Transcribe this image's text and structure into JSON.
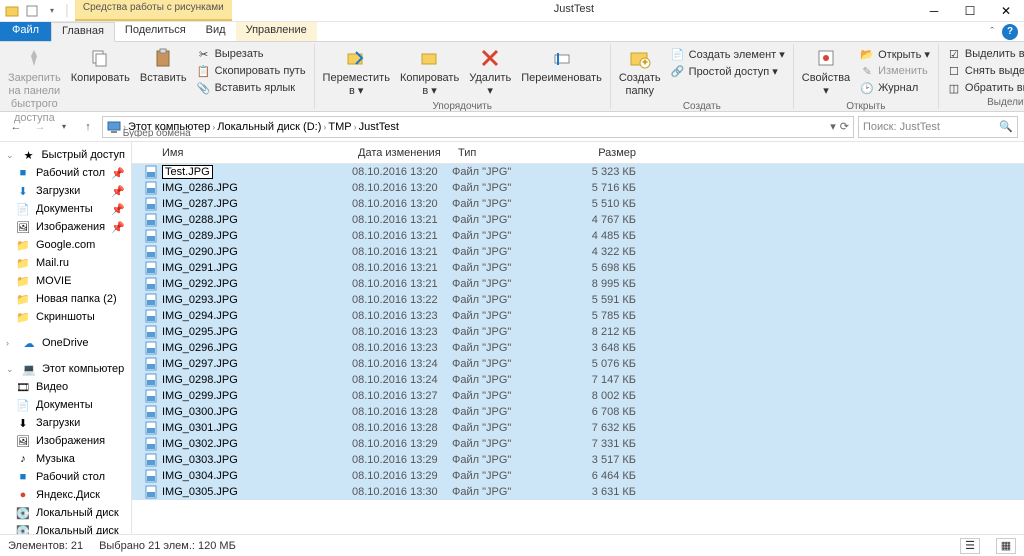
{
  "titlebar": {
    "contextual_tools": "Средства работы с рисунками",
    "title": "JustTest"
  },
  "tabs": {
    "file": "Файл",
    "home": "Главная",
    "share": "Поделиться",
    "view": "Вид",
    "management": "Управление"
  },
  "ribbon": {
    "clipboard": {
      "pin": "Закрепить на панели\nбыстрого доступа",
      "copy": "Копировать",
      "paste": "Вставить",
      "cut": "Вырезать",
      "copy_path": "Скопировать путь",
      "paste_shortcut": "Вставить ярлык",
      "label": "Буфер обмена"
    },
    "organize": {
      "move_to": "Переместить\nв ▾",
      "copy_to": "Копировать\nв ▾",
      "delete": "Удалить\n▾",
      "rename": "Переименовать",
      "label": "Упорядочить"
    },
    "create": {
      "folder": "Создать\nпапку",
      "new_item": "Создать элемент ▾",
      "easy_access": "Простой доступ ▾",
      "label": "Создать"
    },
    "open": {
      "properties": "Свойства\n▾",
      "open": "Открыть ▾",
      "edit": "Изменить",
      "history": "Журнал",
      "label": "Открыть"
    },
    "select": {
      "select_all": "Выделить все",
      "select_none": "Снять выделение",
      "invert": "Обратить выделение",
      "label": "Выделить"
    }
  },
  "breadcrumb": {
    "computer": "Этот компьютер",
    "drive": "Локальный диск (D:)",
    "tmp": "TMP",
    "folder": "JustTest"
  },
  "search": {
    "placeholder": "Поиск: JustTest"
  },
  "sidebar": {
    "quick_access": "Быстрый доступ",
    "desktop": "Рабочий стол",
    "downloads": "Загрузки",
    "documents": "Документы",
    "pictures": "Изображения",
    "google": "Google.com",
    "mailru": "Mail.ru",
    "movie": "MOVIE",
    "newfolder": "Новая папка (2)",
    "screenshots": "Скриншоты",
    "onedrive": "OneDrive",
    "this_pc": "Этот компьютер",
    "video": "Видео",
    "documents2": "Документы",
    "downloads2": "Загрузки",
    "pictures2": "Изображения",
    "music": "Музыка",
    "desktop2": "Рабочий стол",
    "yandex": "Яндекс.Диск",
    "local_c": "Локальный диск",
    "local_d": "Локальный диск"
  },
  "columns": {
    "name": "Имя",
    "date": "Дата изменения",
    "type": "Тип",
    "size": "Размер"
  },
  "rename_value": "Test.JPG",
  "files": [
    {
      "name": "Test.JPG",
      "date": "08.10.2016 13:20",
      "type": "Файл \"JPG\"",
      "size": "5 323 КБ",
      "rename": true
    },
    {
      "name": "IMG_0286.JPG",
      "date": "08.10.2016 13:20",
      "type": "Файл \"JPG\"",
      "size": "5 716 КБ"
    },
    {
      "name": "IMG_0287.JPG",
      "date": "08.10.2016 13:20",
      "type": "Файл \"JPG\"",
      "size": "5 510 КБ"
    },
    {
      "name": "IMG_0288.JPG",
      "date": "08.10.2016 13:21",
      "type": "Файл \"JPG\"",
      "size": "4 767 КБ"
    },
    {
      "name": "IMG_0289.JPG",
      "date": "08.10.2016 13:21",
      "type": "Файл \"JPG\"",
      "size": "4 485 КБ"
    },
    {
      "name": "IMG_0290.JPG",
      "date": "08.10.2016 13:21",
      "type": "Файл \"JPG\"",
      "size": "4 322 КБ"
    },
    {
      "name": "IMG_0291.JPG",
      "date": "08.10.2016 13:21",
      "type": "Файл \"JPG\"",
      "size": "5 698 КБ"
    },
    {
      "name": "IMG_0292.JPG",
      "date": "08.10.2016 13:21",
      "type": "Файл \"JPG\"",
      "size": "8 995 КБ"
    },
    {
      "name": "IMG_0293.JPG",
      "date": "08.10.2016 13:22",
      "type": "Файл \"JPG\"",
      "size": "5 591 КБ"
    },
    {
      "name": "IMG_0294.JPG",
      "date": "08.10.2016 13:23",
      "type": "Файл \"JPG\"",
      "size": "5 785 КБ"
    },
    {
      "name": "IMG_0295.JPG",
      "date": "08.10.2016 13:23",
      "type": "Файл \"JPG\"",
      "size": "8 212 КБ"
    },
    {
      "name": "IMG_0296.JPG",
      "date": "08.10.2016 13:23",
      "type": "Файл \"JPG\"",
      "size": "3 648 КБ"
    },
    {
      "name": "IMG_0297.JPG",
      "date": "08.10.2016 13:24",
      "type": "Файл \"JPG\"",
      "size": "5 076 КБ"
    },
    {
      "name": "IMG_0298.JPG",
      "date": "08.10.2016 13:24",
      "type": "Файл \"JPG\"",
      "size": "7 147 КБ"
    },
    {
      "name": "IMG_0299.JPG",
      "date": "08.10.2016 13:27",
      "type": "Файл \"JPG\"",
      "size": "8 002 КБ"
    },
    {
      "name": "IMG_0300.JPG",
      "date": "08.10.2016 13:28",
      "type": "Файл \"JPG\"",
      "size": "6 708 КБ"
    },
    {
      "name": "IMG_0301.JPG",
      "date": "08.10.2016 13:28",
      "type": "Файл \"JPG\"",
      "size": "7 632 КБ"
    },
    {
      "name": "IMG_0302.JPG",
      "date": "08.10.2016 13:29",
      "type": "Файл \"JPG\"",
      "size": "7 331 КБ"
    },
    {
      "name": "IMG_0303.JPG",
      "date": "08.10.2016 13:29",
      "type": "Файл \"JPG\"",
      "size": "3 517 КБ"
    },
    {
      "name": "IMG_0304.JPG",
      "date": "08.10.2016 13:29",
      "type": "Файл \"JPG\"",
      "size": "6 464 КБ"
    },
    {
      "name": "IMG_0305.JPG",
      "date": "08.10.2016 13:30",
      "type": "Файл \"JPG\"",
      "size": "3 631 КБ"
    }
  ],
  "status": {
    "elements": "Элементов: 21",
    "selected": "Выбрано 21 элем.: 120 МБ"
  }
}
